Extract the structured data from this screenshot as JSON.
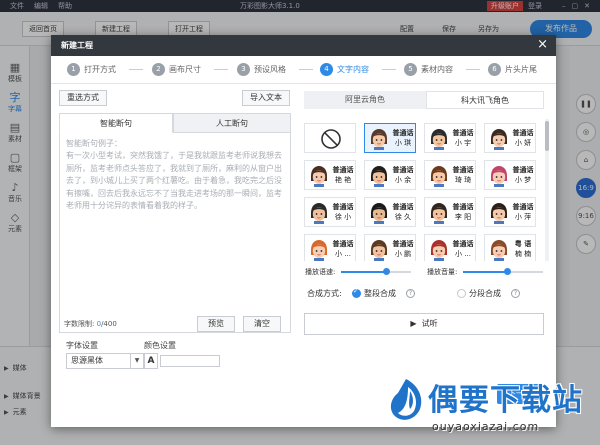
{
  "app": {
    "menu": [
      "文件",
      "编辑",
      "帮助"
    ],
    "title": "万彩图影大师3.1.0",
    "upgrade": "升级账户",
    "login": "登录",
    "toolbar": {
      "back": "返回首页",
      "new_project": "新建工程",
      "open_project": "打开工程",
      "config": "配置",
      "save": "保存",
      "save_as": "另存为",
      "publish": "发布作品"
    },
    "left_rail": [
      {
        "label": "模板",
        "icon": "▦"
      },
      {
        "label": "字幕",
        "icon": "字"
      },
      {
        "label": "素材",
        "icon": "▤"
      },
      {
        "label": "框架",
        "icon": "▢"
      },
      {
        "label": "音乐",
        "icon": "♪"
      },
      {
        "label": "元素",
        "icon": "◇"
      }
    ],
    "right_rail": [
      "16:9",
      "9:16"
    ],
    "timeline": {
      "rows": [
        "媒体",
        "媒体背景",
        "元素"
      ]
    }
  },
  "modal": {
    "title": "新建工程",
    "close": "×",
    "steps": [
      {
        "num": "1",
        "label": "打开方式"
      },
      {
        "num": "2",
        "label": "画布尺寸"
      },
      {
        "num": "3",
        "label": "预设风格"
      },
      {
        "num": "4",
        "label": "文字内容"
      },
      {
        "num": "5",
        "label": "素材内容"
      },
      {
        "num": "6",
        "label": "片头片尾"
      }
    ],
    "left": {
      "reselect": "重选方式",
      "import_text": "导入文本",
      "tab_smart": "智能断句",
      "tab_manual": "人工断句",
      "placeholder": "智能断句例子：\n有一次小型考试，突然我饿了，于是我就跟监考老师说我想去厕所，监考老师点头答应了，我就到了厕所，麻利的从窗户出去了，到小城儿上买了两个红薯吃。由于着急，我吃完之后没有擦嘴，回去后我永远忘不了当我走进考场的那一瞬间，监考老师用十分诧异的表情看着我的样子。",
      "char_limit_label": "字数限制:",
      "char_count": "0",
      "char_max": "/400",
      "preview": "预览",
      "clear": "清空",
      "font_label": "字体设置",
      "font_value": "思源黑体",
      "color_label": "颜色设置",
      "color_glyph": "A"
    },
    "right": {
      "tab_aliyun": "阿里云角色",
      "tab_iflytek": "科大讯飞角色",
      "voices": [
        {
          "type": "none"
        },
        {
          "line1": "普通话",
          "line2": "小 琪",
          "face": "girl-bob",
          "selected": true
        },
        {
          "line1": "普通话",
          "line2": "小 宇",
          "face": "boy-short"
        },
        {
          "line1": "普通话",
          "line2": "小 妍",
          "face": "girl-long"
        },
        {
          "line1": "普通话",
          "line2": "艳 艳",
          "face": "girl-bun"
        },
        {
          "line1": "普通话",
          "line2": "小 余",
          "face": "boy-spiky"
        },
        {
          "line1": "普通话",
          "line2": "琦 琦",
          "face": "girl-curly"
        },
        {
          "line1": "普通话",
          "line2": "小 梦",
          "face": "girl-pink"
        },
        {
          "line1": "普通话",
          "line2": "徐 小",
          "face": "boy-glasses"
        },
        {
          "line1": "普通话",
          "line2": "徐 久",
          "face": "boy-dark"
        },
        {
          "line1": "普通话",
          "line2": "李 阳",
          "face": "boy-side"
        },
        {
          "line1": "普通话",
          "line2": "小 萍",
          "face": "girl-twin"
        },
        {
          "line1": "普通话",
          "line2": "小 ...",
          "face": "girl-orange"
        },
        {
          "line1": "普通话",
          "line2": "小 鹏",
          "face": "boy-brown"
        },
        {
          "line1": "普通话",
          "line2": "小 ...",
          "face": "girl-red"
        },
        {
          "line1": "粤 语",
          "line2": "楠 楠",
          "face": "girl-hat"
        }
      ],
      "speed_label": "播放语速:",
      "speed_value": 0.65,
      "volume_label": "播放音量:",
      "volume_value": 0.55,
      "synth_label": "合成方式:",
      "mode_whole": "整段合成",
      "mode_segment": "分段合成",
      "help": "?",
      "listen": "试听"
    },
    "footer": {
      "next": "下一步"
    }
  },
  "watermark": {
    "text": "偶要下载站",
    "url": "ouyaoxiazai.com"
  },
  "colors": {
    "accent": "#2e8ae6",
    "header": "#33383f",
    "watermark": "#1f73c9"
  }
}
